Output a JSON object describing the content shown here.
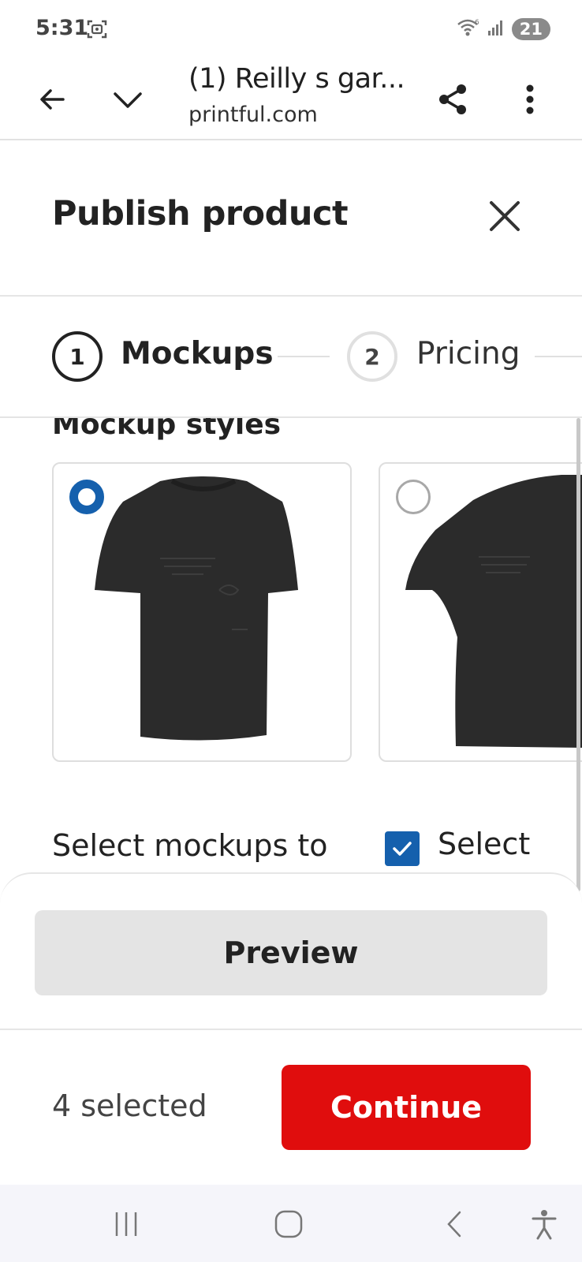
{
  "status_bar": {
    "time": "5:31",
    "screenshot_icon": "screenshot-icon",
    "wifi_icon": "wifi-icon",
    "signal_icon": "signal-icon",
    "battery": "21"
  },
  "browser": {
    "back_icon": "arrow-left-icon",
    "tabs_icon": "chevron-down-icon",
    "title": "(1) Reilly s gar...",
    "url": "printful.com",
    "share_icon": "share-icon",
    "menu_icon": "more-vertical-icon"
  },
  "modal": {
    "title": "Publish product",
    "close_icon": "close-icon"
  },
  "stepper": {
    "steps": [
      {
        "number": "1",
        "label": "Mockups",
        "state": "active"
      },
      {
        "number": "2",
        "label": "Pricing",
        "state": "inactive"
      }
    ]
  },
  "mockups": {
    "section_title": "Mockup styles",
    "styles": [
      {
        "name": "front-flat",
        "selected": true
      },
      {
        "name": "model-side",
        "selected": false
      }
    ],
    "select_label": "Select mockups to",
    "select_all_label": "Select",
    "select_all_checked": true
  },
  "footer": {
    "preview_label": "Preview",
    "selected_count": "4 selected",
    "continue_label": "Continue"
  },
  "nav": {
    "recents_icon": "recents-icon",
    "home_icon": "home-icon",
    "back_icon": "back-icon",
    "accessibility_icon": "accessibility-icon"
  },
  "colors": {
    "primary_blue": "#1560ad",
    "continue_red": "#e00d0d",
    "shirt": "#2b2b2b"
  }
}
